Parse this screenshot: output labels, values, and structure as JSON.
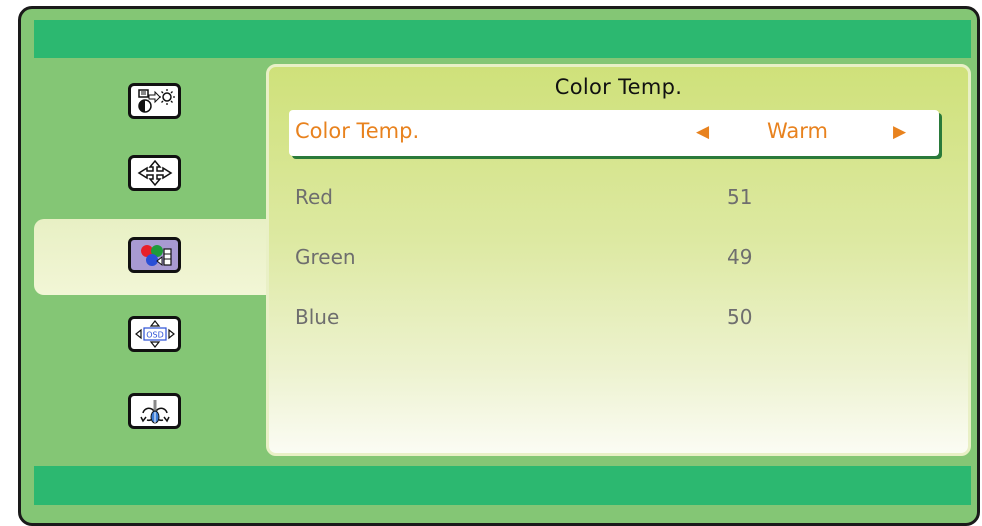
{
  "panel": {
    "title": "Color Temp.",
    "selected_item": {
      "label": "Color Temp.",
      "value": "Warm",
      "left_arrow": "◀",
      "right_arrow": "▶"
    },
    "items": [
      {
        "label": "Red",
        "value": "51"
      },
      {
        "label": "Green",
        "value": "49"
      },
      {
        "label": "Blue",
        "value": "50"
      }
    ]
  },
  "sidebar": {
    "items": [
      {
        "icon": "brightness-contrast-icon"
      },
      {
        "icon": "position-icon"
      },
      {
        "icon": "color-icon",
        "selected": true
      },
      {
        "icon": "osd-position-icon"
      },
      {
        "icon": "reset-icon"
      }
    ]
  },
  "colors": {
    "frame_green": "#84c675",
    "band_green": "#2cb870",
    "highlight_orange": "#e8821e"
  }
}
